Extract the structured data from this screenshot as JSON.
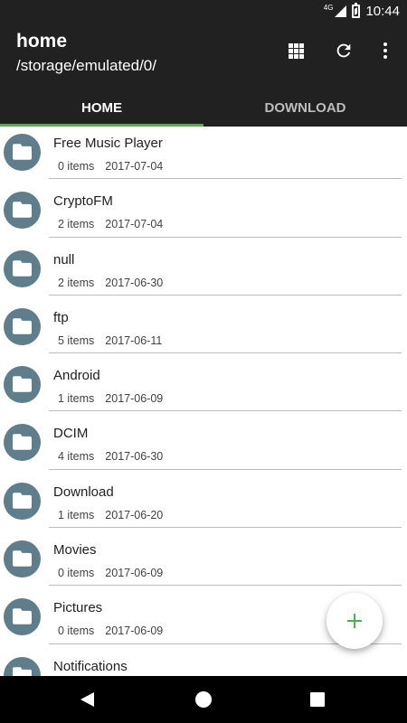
{
  "status_bar": {
    "network": "4G",
    "time": "10:44"
  },
  "app_bar": {
    "title": "home",
    "path": "/storage/emulated/0/"
  },
  "actions": [
    "grid-view-icon",
    "refresh-icon",
    "more-options-icon"
  ],
  "tabs": [
    {
      "label": "HOME",
      "selected": true
    },
    {
      "label": "DOWNLOAD",
      "selected": false
    }
  ],
  "colors": {
    "toolbar": "#212121",
    "tab_indicator": "#4caf50",
    "folder_avatar": "#607d8b",
    "fab_plus": "#4caf50"
  },
  "folders": [
    {
      "name": "Free Music Player",
      "items": "0 items",
      "date": "2017-07-04"
    },
    {
      "name": "CryptoFM",
      "items": "2 items",
      "date": "2017-07-04"
    },
    {
      "name": "null",
      "items": "2 items",
      "date": "2017-06-30"
    },
    {
      "name": "ftp",
      "items": "5 items",
      "date": "2017-06-11"
    },
    {
      "name": "Android",
      "items": "1 items",
      "date": "2017-06-09"
    },
    {
      "name": "DCIM",
      "items": "4 items",
      "date": "2017-06-30"
    },
    {
      "name": "Download",
      "items": "1 items",
      "date": "2017-06-20"
    },
    {
      "name": "Movies",
      "items": "0 items",
      "date": "2017-06-09"
    },
    {
      "name": "Pictures",
      "items": "0 items",
      "date": "2017-06-09"
    },
    {
      "name": "Notifications",
      "items": "",
      "date": ""
    }
  ],
  "fab": {
    "icon": "plus-icon"
  },
  "nav_bar": {
    "icons": [
      "back-icon",
      "home-icon",
      "recents-icon"
    ]
  }
}
